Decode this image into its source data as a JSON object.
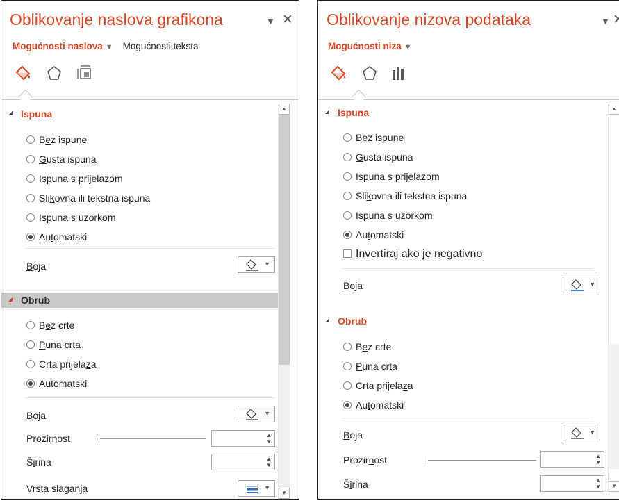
{
  "left_panel": {
    "title": "Oblikovanje naslova grafikona",
    "menu_caret": "▼",
    "close": "✕",
    "subtab_active": "Mogućnosti naslova",
    "subtab_caret": "▼",
    "subtab_other": "Mogućnosti teksta",
    "icons": [
      "fill-bucket-icon",
      "pentagon-icon",
      "size-properties-icon"
    ],
    "sections": {
      "fill": {
        "title": "Ispuna",
        "options": [
          {
            "pre": "B",
            "u": "e",
            "post": "z ispune"
          },
          {
            "pre": "",
            "u": "G",
            "post": "usta ispuna"
          },
          {
            "pre": "",
            "u": "I",
            "post": "spuna s prijelazom"
          },
          {
            "pre": "Sli",
            "u": "k",
            "post": "ovna ili tekstna ispuna"
          },
          {
            "pre": "I",
            "u": "s",
            "post": "puna s uzorkom"
          },
          {
            "pre": "Au",
            "u": "t",
            "post": "omatski"
          }
        ],
        "selected_index": 5,
        "color_label_u": "B",
        "color_label_post": "oja"
      },
      "border": {
        "title": "Obrub",
        "options": [
          {
            "pre": "B",
            "u": "e",
            "post": "z crte"
          },
          {
            "pre": "",
            "u": "P",
            "post": "una crta"
          },
          {
            "pre": "Crta prijela",
            "u": "z",
            "post": "a"
          },
          {
            "pre": "Au",
            "u": "t",
            "post": "omatski"
          }
        ],
        "selected_index": 3,
        "color_label_u": "B",
        "color_label_post": "oja",
        "transparency_pre": "Prozir",
        "transparency_u": "n",
        "transparency_post": "ost",
        "width_pre": "Š",
        "width_u": "i",
        "width_post": "rina",
        "compound_pre": "Vrsta sla",
        "compound_u": "g",
        "compound_post": "anja"
      }
    }
  },
  "right_panel": {
    "title": "Oblikovanje nizova podataka",
    "menu_caret": "▼",
    "close": "✕",
    "subtab_active": "Mogućnosti niza",
    "subtab_caret": "▼",
    "icons": [
      "fill-bucket-icon",
      "pentagon-icon",
      "bar-chart-icon"
    ],
    "sections": {
      "fill": {
        "title": "Ispuna",
        "options": [
          {
            "pre": "B",
            "u": "e",
            "post": "z ispune"
          },
          {
            "pre": "",
            "u": "G",
            "post": "usta ispuna"
          },
          {
            "pre": "",
            "u": "I",
            "post": "spuna s prijelazom"
          },
          {
            "pre": "Sli",
            "u": "k",
            "post": "ovna ili tekstna ispuna"
          },
          {
            "pre": "I",
            "u": "s",
            "post": "puna s uzorkom"
          },
          {
            "pre": "Au",
            "u": "t",
            "post": "omatski"
          }
        ],
        "selected_index": 5,
        "invert_pre": "",
        "invert_u": "I",
        "invert_post": "nvertiraj ako je negativno",
        "color_label_u": "B",
        "color_label_post": "oja"
      },
      "border": {
        "title": "Obrub",
        "options": [
          {
            "pre": "B",
            "u": "e",
            "post": "z crte"
          },
          {
            "pre": "",
            "u": "P",
            "post": "una crta"
          },
          {
            "pre": "Crta prijela",
            "u": "z",
            "post": "a"
          },
          {
            "pre": "Au",
            "u": "t",
            "post": "omatski"
          }
        ],
        "selected_index": 3,
        "color_label_u": "B",
        "color_label_post": "oja",
        "transparency_pre": "Prozir",
        "transparency_u": "n",
        "transparency_post": "ost",
        "width_pre": "Š",
        "width_u": "i",
        "width_post": "rina"
      }
    }
  },
  "colors": {
    "accent": "#d24726",
    "section_shade": "#c9c9c9",
    "text": "#262626",
    "border": "#ababab"
  }
}
